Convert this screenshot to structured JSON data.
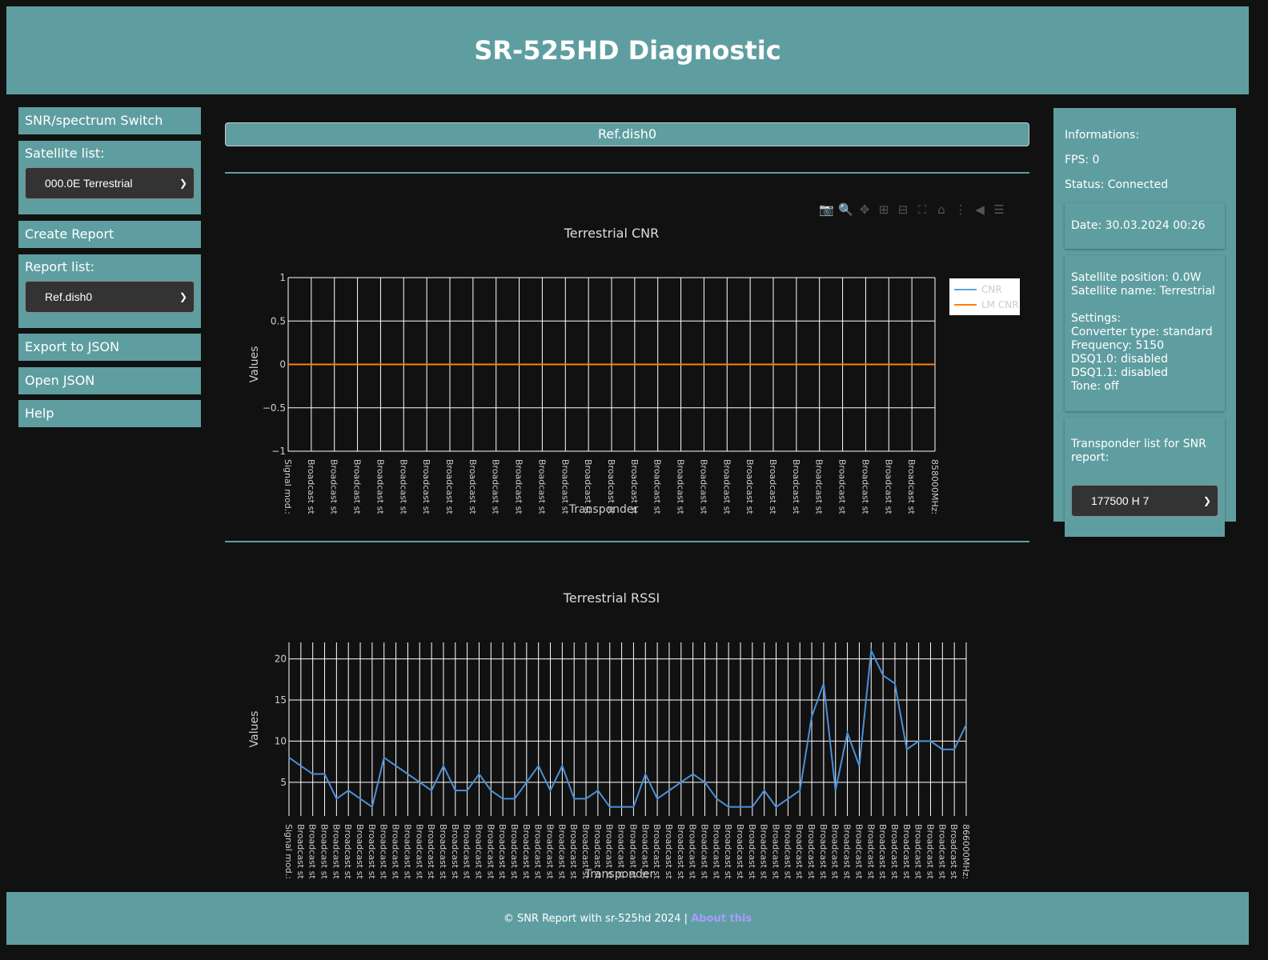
{
  "header": {
    "title": "SR-525HD Diagnostic"
  },
  "sidebar": {
    "snr_switch": "SNR/spectrum Switch",
    "satellite_label": "Satellite list:",
    "satellite_selected": "000.0E Terrestrial",
    "create_report": "Create Report",
    "report_label": "Report list:",
    "report_selected": "Ref.dish0",
    "export_json": "Export to JSON",
    "open_json": "Open JSON",
    "help": "Help"
  },
  "main": {
    "report_title": "Ref.dish0",
    "toolbar": [
      "camera-icon",
      "zoom-icon",
      "pan-icon",
      "zoom-in-icon",
      "zoom-out-icon",
      "autoscale-icon",
      "reset-axes-icon",
      "spike-lines-icon",
      "hover-closest-icon",
      "hover-compare-icon"
    ]
  },
  "chart_data": [
    {
      "type": "line",
      "title": "Terrestrial CNR",
      "xlabel": "Transponder",
      "ylabel": "Values",
      "ylim": [
        -1,
        1
      ],
      "yticks": [
        "1",
        "0.5",
        "0",
        "−0.5",
        "−1"
      ],
      "grid": true,
      "legend": "top-right",
      "first_label": "Signal mod.:",
      "repeat_label": "Broadcast st",
      "last_label": "858000MHz:",
      "category_count": 29,
      "series": [
        {
          "name": "CNR",
          "color": "#5da5da",
          "values": []
        },
        {
          "name": "LM CNR",
          "color": "#ff7f0e",
          "values": [
            0,
            0,
            0,
            0,
            0,
            0,
            0,
            0,
            0,
            0,
            0,
            0,
            0,
            0,
            0,
            0,
            0,
            0,
            0,
            0,
            0,
            0,
            0,
            0,
            0,
            0,
            0,
            0,
            0
          ]
        }
      ]
    },
    {
      "type": "line",
      "title": "Terrestrial RSSI",
      "xlabel": "Transponder",
      "ylabel": "Values",
      "ylim": [
        0.9,
        22
      ],
      "yticks": [
        "20",
        "15",
        "10",
        "5"
      ],
      "grid": true,
      "first_label": "Signal mod.:",
      "repeat_label": "Broadcast st",
      "last_label": "866000MHz:",
      "series": [
        {
          "color": "#4a90d9",
          "values": [
            8,
            7,
            6,
            6,
            3,
            4,
            3,
            2,
            8,
            7,
            6,
            5,
            4,
            7,
            4,
            4,
            6,
            4,
            3,
            3,
            5,
            7,
            4,
            7,
            3,
            3,
            4,
            2,
            2,
            2,
            6,
            3,
            4,
            5,
            6,
            5,
            3,
            2,
            2,
            2,
            4,
            2,
            3,
            4,
            13,
            17,
            4,
            11,
            7,
            21,
            18,
            17,
            9,
            10,
            10,
            9,
            9,
            12
          ]
        }
      ]
    }
  ],
  "info": {
    "title": "Informations:",
    "fps": "FPS: 0",
    "status": "Status: Connected",
    "date": "Date: 30.03.2024 00:26",
    "satellite": "Satellite position: 0.0W\nSatellite name: Terrestrial\n\nSettings:\nConverter type: standard\nFrequency: 5150\nDSQ1.0: disabled\nDSQ1.1: disabled\nTone: off",
    "transponder_label": "Transponder list for SNR report:",
    "transponder_selected": "177500 H 7"
  },
  "footer": {
    "text": "© SNR Report with sr-525hd 2024 | ",
    "link": "About this"
  }
}
